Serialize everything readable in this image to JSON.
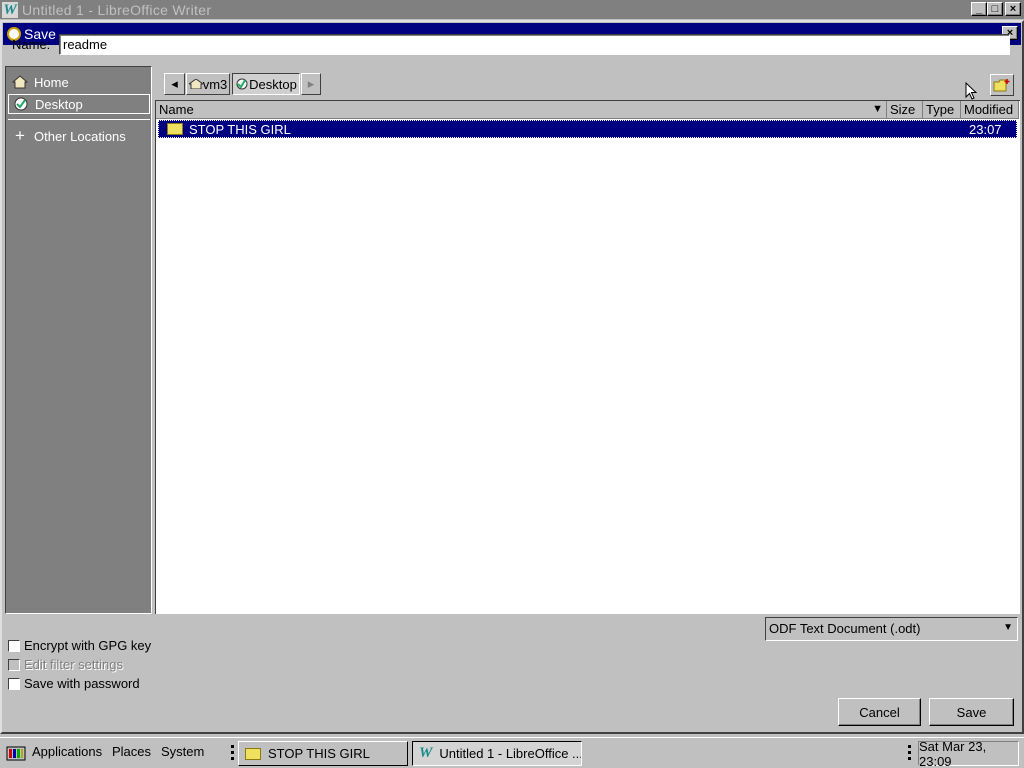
{
  "window": {
    "title": "Untitled 1 - LibreOffice Writer",
    "app_icon_glyph": "W",
    "minimize": "_",
    "maximize": "□",
    "close": "×"
  },
  "dialog": {
    "title": "Save",
    "close": "×",
    "name_label": "Name:",
    "name_value": "readme"
  },
  "sidebar": {
    "items": [
      {
        "label": "Home",
        "icon": "home-icon"
      },
      {
        "label": "Desktop",
        "icon": "desktop-icon",
        "selected": true
      },
      {
        "label": "Other Locations",
        "icon": "plus-icon"
      }
    ]
  },
  "pathbar": {
    "back": "◂",
    "forward": "▸",
    "segments": [
      "vm3",
      "Desktop"
    ],
    "active_segment": "Desktop"
  },
  "filelist": {
    "columns": [
      "Name",
      "Size",
      "Type",
      "Modified"
    ],
    "sort_indicator": "▼",
    "rows": [
      {
        "name": "STOP THIS GIRL",
        "size": "",
        "type": "",
        "modified": "23:07",
        "kind": "folder",
        "selected": true
      }
    ]
  },
  "options": {
    "encrypt_label": "Encrypt with GPG key",
    "edit_filter_label": "Edit filter settings",
    "password_label": "Save with password"
  },
  "filter": {
    "selected": "ODF Text Document (.odt)"
  },
  "buttons": {
    "cancel": "Cancel",
    "save": "Save"
  },
  "taskbar": {
    "applications": "Applications",
    "places": "Places",
    "system": "System",
    "tasks": [
      {
        "label": "STOP THIS GIRL",
        "icon": "folder-icon"
      },
      {
        "label": "Untitled 1 - LibreOffice ...",
        "icon": "writer-icon",
        "active": true
      }
    ],
    "clock": "Sat Mar 23, 23:09"
  },
  "colors": {
    "selection": "#000080",
    "face": "#c0c0c0",
    "sidebar": "#808080"
  }
}
